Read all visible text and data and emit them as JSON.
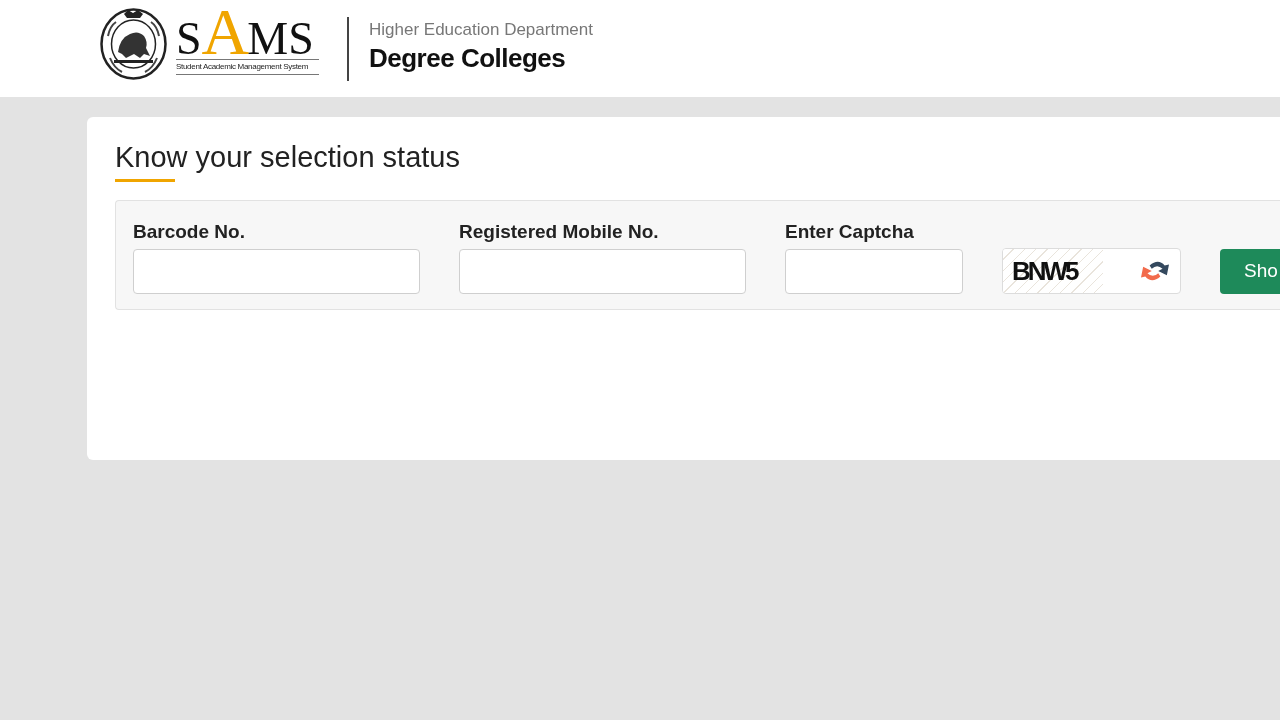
{
  "header": {
    "logo": {
      "letters": [
        {
          "text": "S",
          "accent": false
        },
        {
          "text": "A",
          "accent": true
        },
        {
          "text": "M",
          "accent": false
        },
        {
          "text": "S",
          "accent": false
        }
      ],
      "tagline": "Student Academic Management System"
    },
    "department": "Higher Education Department",
    "portal": "Degree Colleges"
  },
  "page_title": "Know your selection status",
  "form": {
    "fields": [
      {
        "label": "Barcode No."
      },
      {
        "label": "Registered Mobile No."
      },
      {
        "label": "Enter Captcha"
      }
    ],
    "captcha": {
      "text": "BNW5"
    },
    "submit_button": "Sho"
  }
}
